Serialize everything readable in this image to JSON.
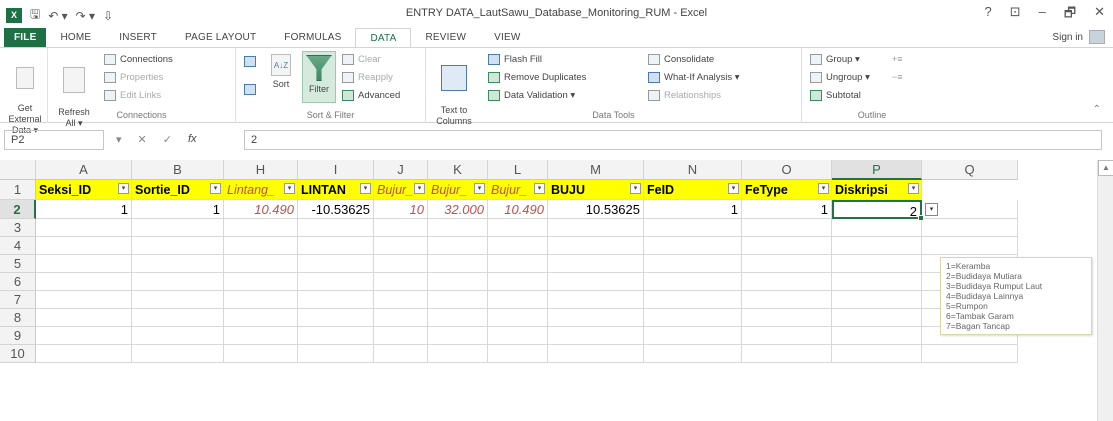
{
  "window": {
    "title": "ENTRY DATA_LautSawu_Database_Monitoring_RUM - Excel",
    "controls": [
      "?",
      "⊡",
      "–",
      "🗗",
      "✕"
    ],
    "logo_text": "X"
  },
  "tabs": [
    {
      "label": "FILE"
    },
    {
      "label": "HOME"
    },
    {
      "label": "INSERT"
    },
    {
      "label": "PAGE LAYOUT"
    },
    {
      "label": "FORMULAS"
    },
    {
      "label": "DATA"
    },
    {
      "label": "REVIEW"
    },
    {
      "label": "VIEW"
    }
  ],
  "signin": "Sign in",
  "ribbon": {
    "get_external": "Get External\nData ▾",
    "refresh": "Refresh\nAll ▾",
    "connections": "Connections",
    "properties": "Properties",
    "edit_links": "Edit Links",
    "connections_group": "Connections",
    "sort_az": "A↓Z",
    "sort_label": "Sort",
    "filter_label": "Filter",
    "clear": "Clear",
    "reapply": "Reapply",
    "advanced": "Advanced",
    "sort_filter_group": "Sort & Filter",
    "text_to_columns": "Text to\nColumns",
    "flash_fill": "Flash Fill",
    "remove_duplicates": "Remove Duplicates",
    "data_validation": "Data Validation ▾",
    "consolidate": "Consolidate",
    "what_if": "What-If Analysis ▾",
    "relationships": "Relationships",
    "data_tools_group": "Data Tools",
    "group": "Group ▾",
    "ungroup": "Ungroup ▾",
    "subtotal": "Subtotal",
    "outline_group": "Outline"
  },
  "formula_bar": {
    "name_box": "P2",
    "value": "2"
  },
  "columns": [
    {
      "letter": "A",
      "header": "Seksi_ID",
      "italic": false
    },
    {
      "letter": "B",
      "header": "Sortie_ID",
      "italic": false
    },
    {
      "letter": "H",
      "header": "Lintang_",
      "italic": true
    },
    {
      "letter": "I",
      "header": "LINTAN",
      "italic": false
    },
    {
      "letter": "J",
      "header": "Bujur_",
      "italic": true
    },
    {
      "letter": "K",
      "header": "Bujur_",
      "italic": true
    },
    {
      "letter": "L",
      "header": "Bujur_",
      "italic": true
    },
    {
      "letter": "M",
      "header": "BUJU",
      "italic": false
    },
    {
      "letter": "N",
      "header": "FeID",
      "italic": false
    },
    {
      "letter": "O",
      "header": "FeType",
      "italic": false
    },
    {
      "letter": "P",
      "header": "Diskripsi",
      "italic": false
    },
    {
      "letter": "Q",
      "header": "",
      "italic": false
    }
  ],
  "row2": [
    "1",
    "1",
    "10.490",
    "-10.53625",
    "10",
    "32.000",
    "10.490",
    "10.53625",
    "1",
    "1",
    "2",
    ""
  ],
  "row_numbers": [
    "1",
    "2",
    "3",
    "4",
    "5",
    "6",
    "7",
    "8",
    "9",
    "10"
  ],
  "tooltip": [
    "1=Keramba",
    "2=Budidaya Mutiara",
    "3=Budidaya Rumput Laut",
    "4=Budidaya Lainnya",
    "5=Rumpon",
    "6=Tambak Garam",
    "7=Bagan Tancap"
  ],
  "colors": {
    "excel_green": "#217346",
    "header_yellow": "#ffff00",
    "italic_red": "#c0504d"
  }
}
